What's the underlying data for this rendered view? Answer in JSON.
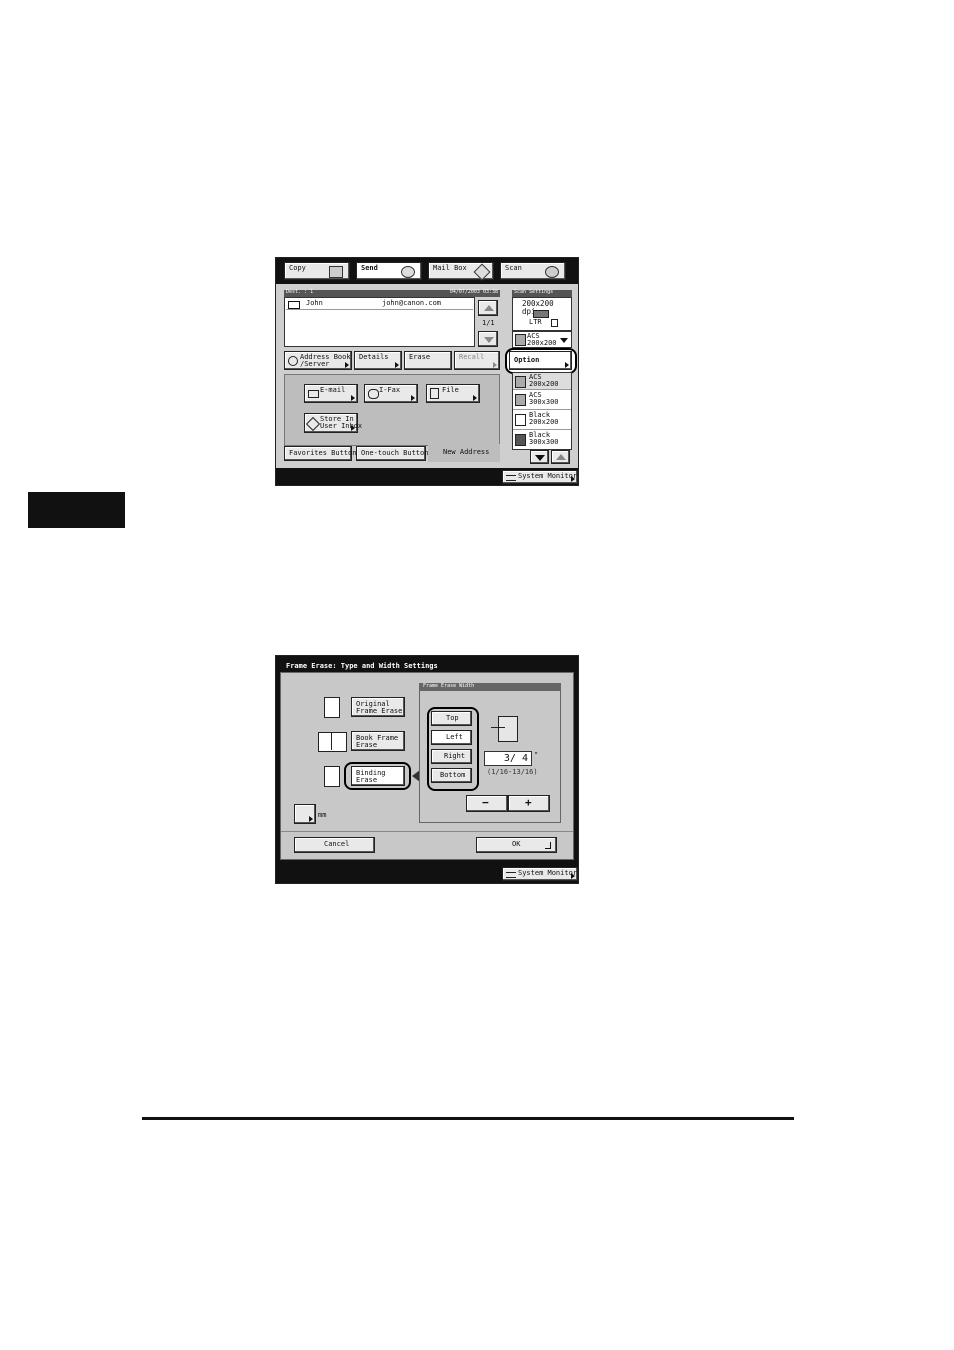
{
  "screen1": {
    "tabs": [
      "Copy",
      "Send",
      "Mail Box",
      "Scan"
    ],
    "doc_header": "Dest. :  1",
    "doc_date": "04/07/2003 03:38",
    "dest_name": "John",
    "dest_email": "john@canon.com",
    "page_counter": "1/1",
    "scan_settings_title": "Scan Settings",
    "resolution": "200x200 dpi",
    "size_label": "LTR",
    "mode_selected": "ACS\n200x200",
    "option_label": "Option",
    "mode_list": [
      {
        "label": "ACS\n200x200"
      },
      {
        "label": "ACS\n300x300"
      },
      {
        "label": "Black\n200x200"
      },
      {
        "label": "Black\n300x300"
      }
    ],
    "action_buttons": [
      "Address Book\n/Server",
      "Details",
      "Erase",
      "Recall"
    ],
    "dest_buttons": [
      "E-mail",
      "I-Fax",
      "File"
    ],
    "store_button": "Store In\nUser Inbox",
    "bottom_tabs": [
      "Favorites Buttons",
      "One-touch Buttons",
      "New Address"
    ],
    "system_monitor": "System Monitor"
  },
  "screen2": {
    "title": "Frame Erase: Type and Width Settings",
    "options": [
      "Original\nFrame Erase",
      "Book Frame\nErase",
      "Binding\nErase"
    ],
    "unit_label": "mm",
    "width_group_title": "Frame Erase Width",
    "side_buttons": [
      "Top",
      "Left",
      "Right",
      "Bottom"
    ],
    "value": "3/ 4",
    "unit_symbol": "\"",
    "range": "(1/16-13/16)",
    "minus": "−",
    "plus": "+",
    "cancel": "Cancel",
    "ok": "OK",
    "system_monitor": "System Monitor"
  }
}
